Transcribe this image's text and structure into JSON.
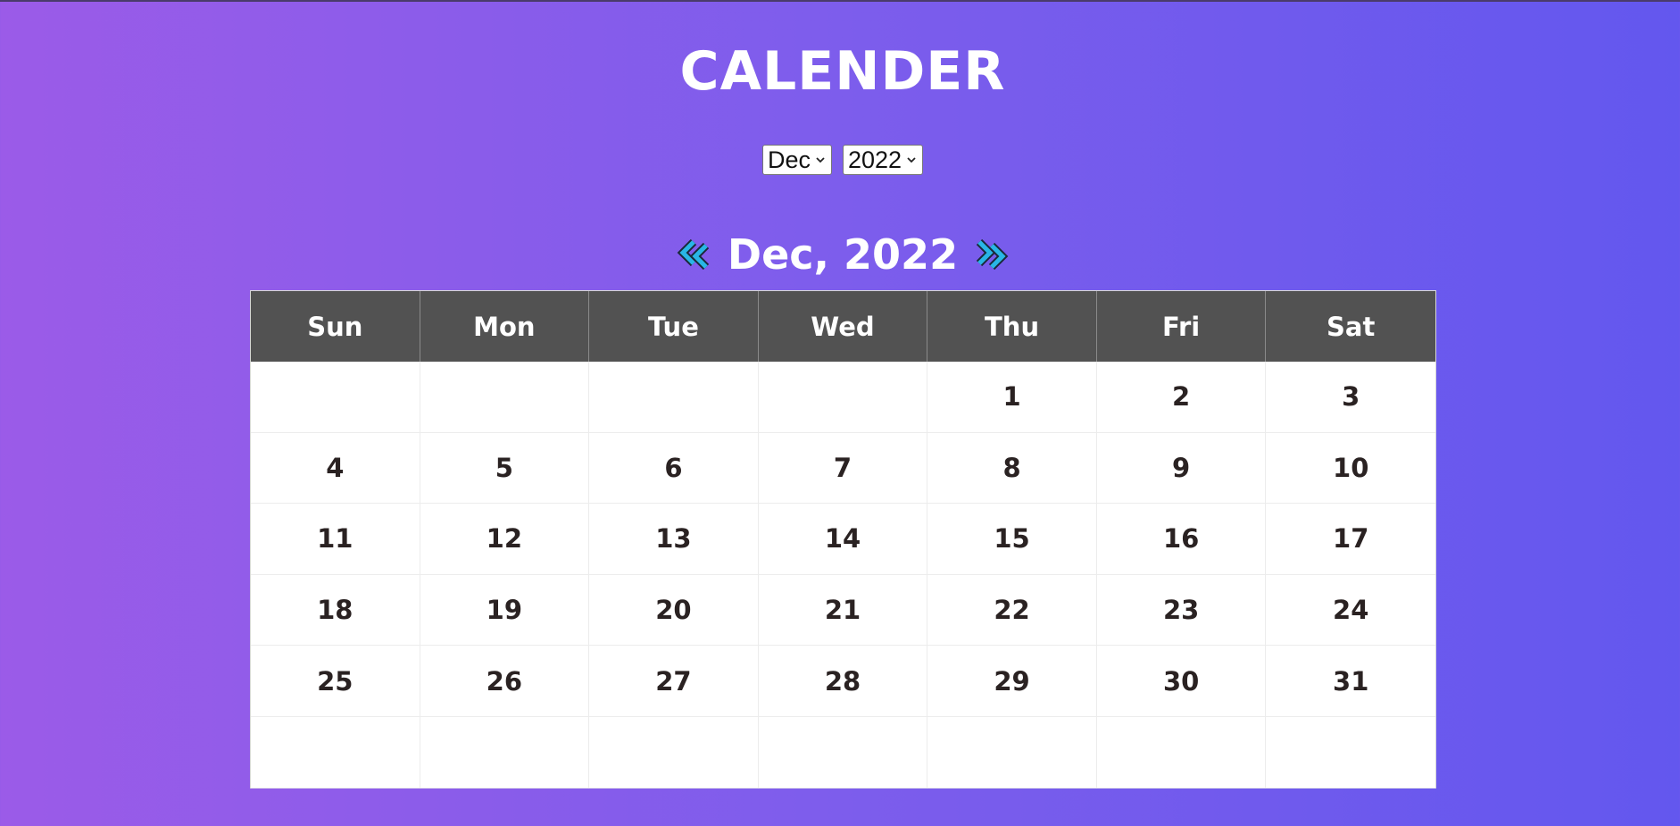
{
  "title": "CALENDER",
  "month_select": {
    "value": "Dec"
  },
  "year_select": {
    "value": "2022"
  },
  "heading": {
    "label": "Dec, 2022"
  },
  "weekdays": [
    "Sun",
    "Mon",
    "Tue",
    "Wed",
    "Thu",
    "Fri",
    "Sat"
  ],
  "days": [
    "",
    "",
    "",
    "",
    "1",
    "2",
    "3",
    "4",
    "5",
    "6",
    "7",
    "8",
    "9",
    "10",
    "11",
    "12",
    "13",
    "14",
    "15",
    "16",
    "17",
    "18",
    "19",
    "20",
    "21",
    "22",
    "23",
    "24",
    "25",
    "26",
    "27",
    "28",
    "29",
    "30",
    "31",
    "",
    "",
    "",
    "",
    "",
    "",
    ""
  ],
  "colors": {
    "background_left": "#9b5be8",
    "background_right": "#6357ee",
    "header_bg": "#525252",
    "arrow": "#29b6e6"
  },
  "icons": {
    "prev": "double-chevron-left-icon",
    "next": "double-chevron-right-icon"
  }
}
